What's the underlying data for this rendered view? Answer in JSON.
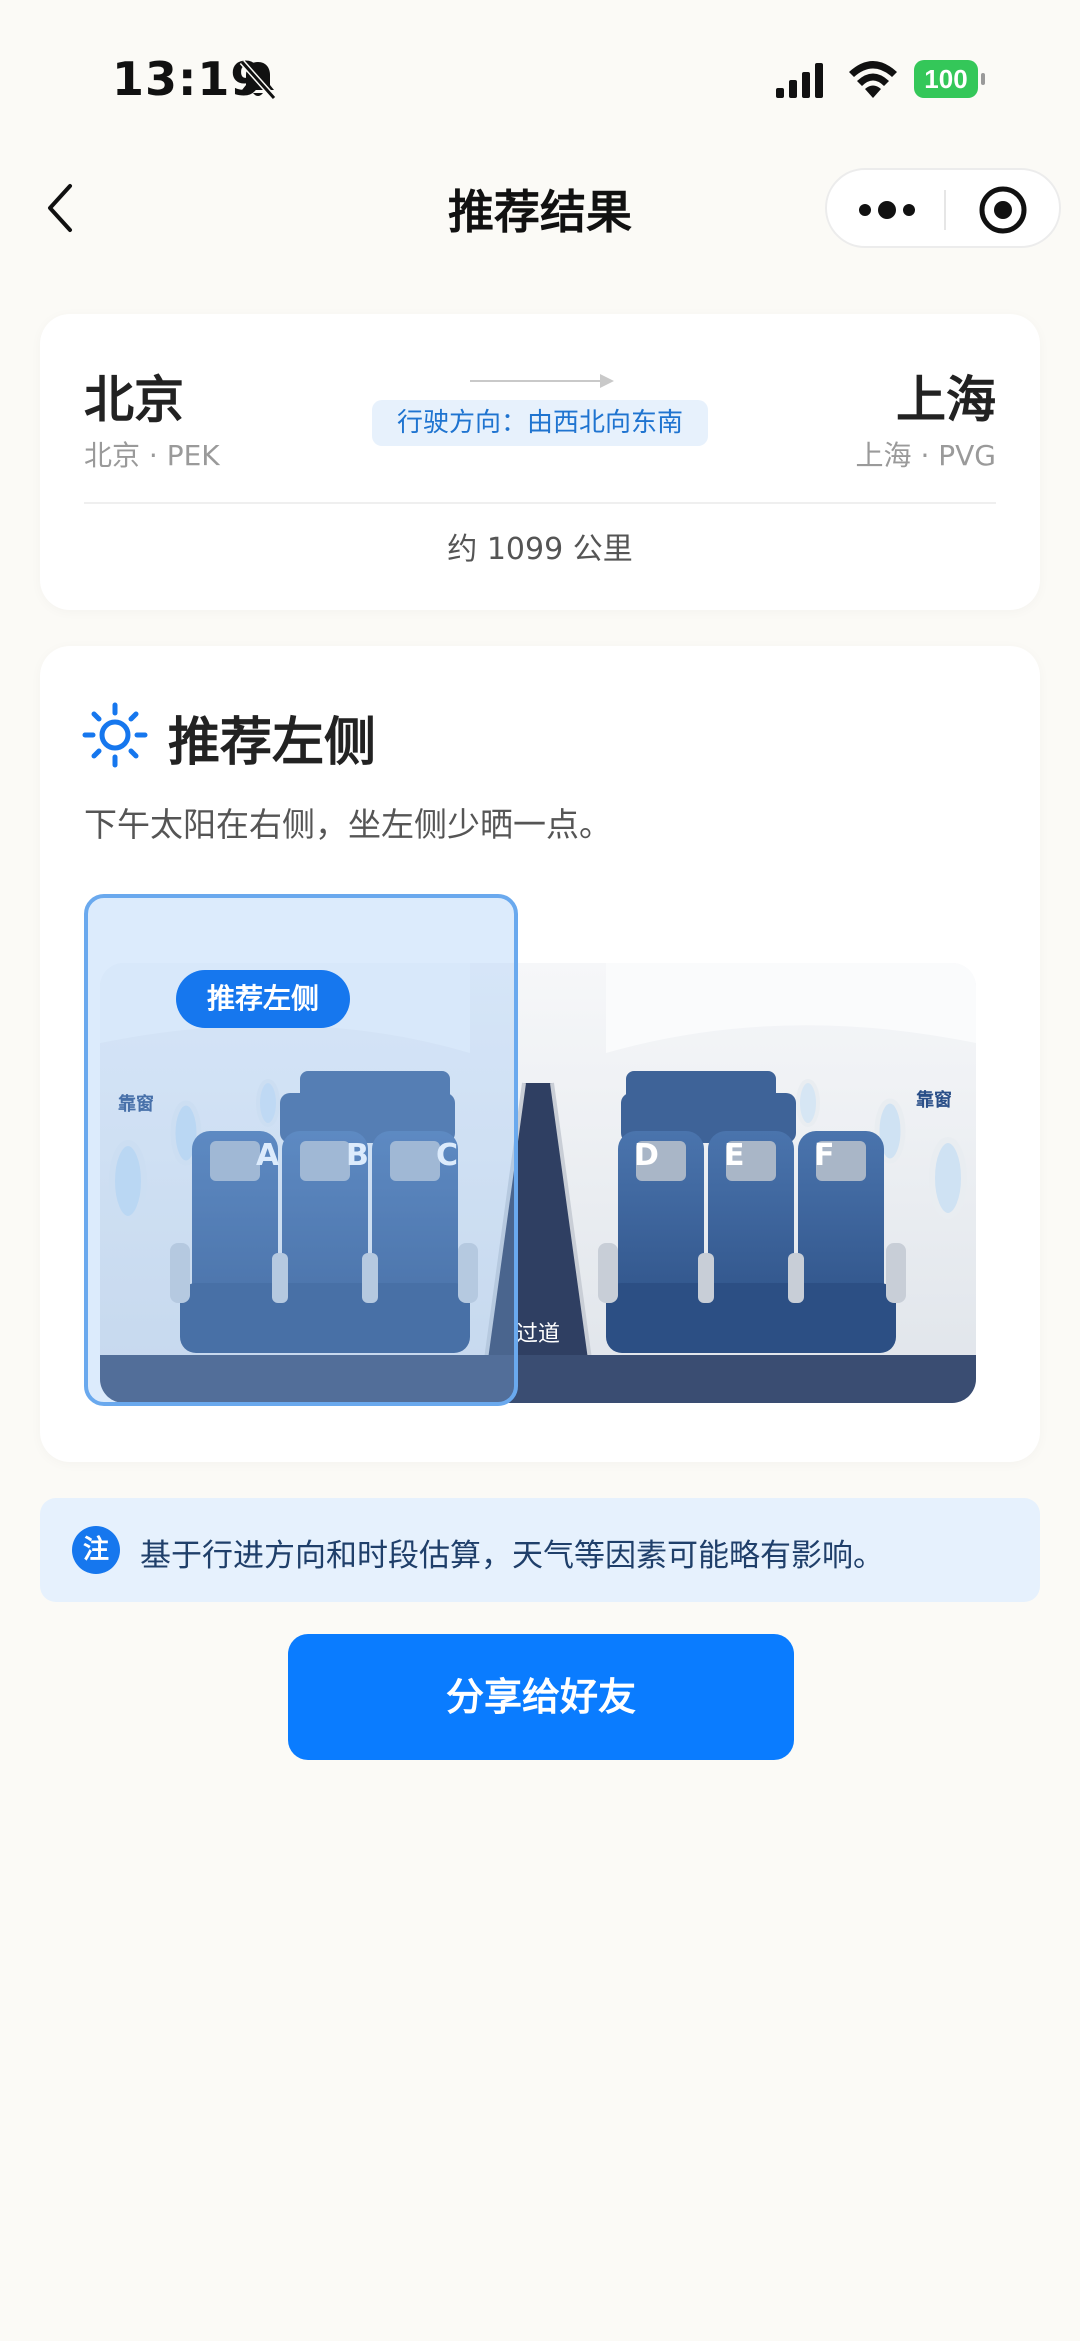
{
  "status_bar": {
    "time": "13:19",
    "battery": "100",
    "icons": [
      "bell-off-icon",
      "signal-icon",
      "wifi-icon",
      "battery-icon"
    ],
    "battery_color": "#34c759"
  },
  "nav": {
    "title": "推荐结果",
    "icons": [
      "back-chevron-icon",
      "more-dots-icon",
      "target-icon"
    ]
  },
  "route": {
    "from_city": "北京",
    "from_code": "北京 · PEK",
    "to_city": "上海",
    "to_code": "上海 · PVG",
    "direction": "行驶方向：由西北向东南",
    "distance": "约 1099 公里"
  },
  "recommendation": {
    "icon": "sun-icon",
    "title": "推荐左侧",
    "description": "下午太阳在右侧，坐左侧少晒一点。",
    "highlight_label": "推荐左侧",
    "cabin": {
      "window_label_left": "靠窗",
      "window_label_right": "靠窗",
      "aisle_label": "过道",
      "seats": [
        "A",
        "B",
        "C",
        "D",
        "E",
        "F"
      ]
    }
  },
  "note": {
    "badge": "注",
    "text": "基于行进方向和时段估算，天气等因素可能略有影响。"
  },
  "actions": {
    "share_label": "分享给好友"
  },
  "colors": {
    "accent": "#0a7cff",
    "background": "#fbfaf6",
    "note_background": "#e6f1fd"
  }
}
